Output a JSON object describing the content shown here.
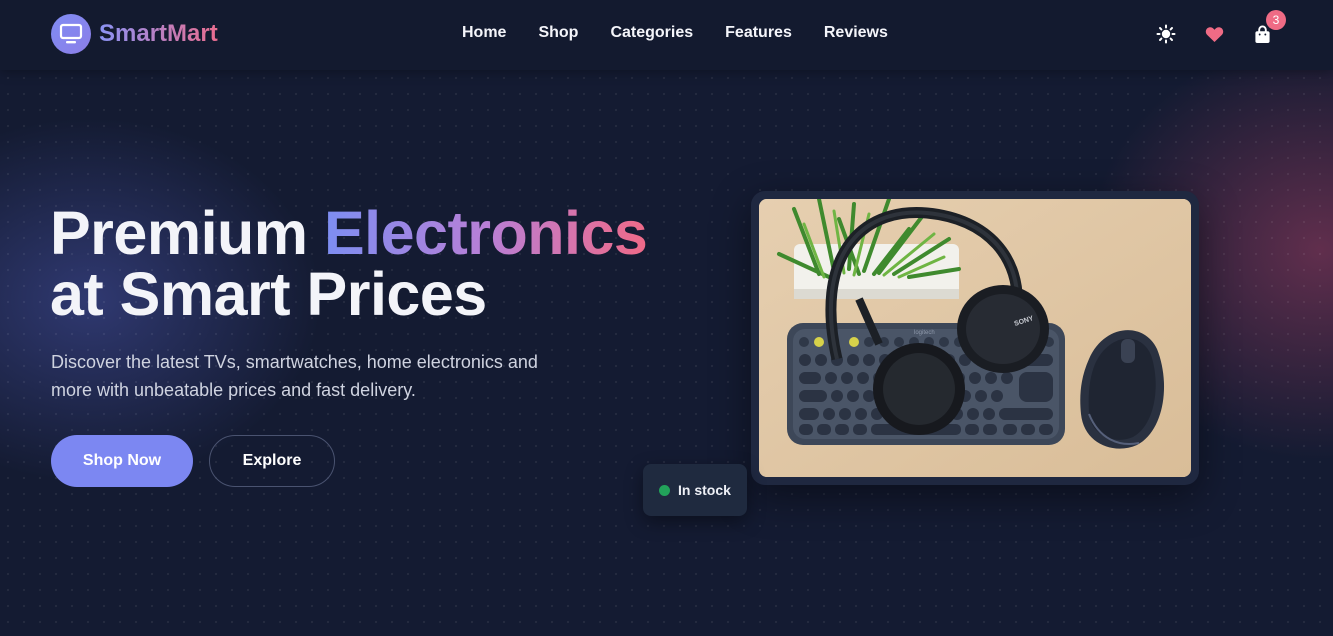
{
  "brand": {
    "name": "SmartMart",
    "icon": "monitor-icon"
  },
  "nav": {
    "items": [
      {
        "label": "Home"
      },
      {
        "label": "Shop"
      },
      {
        "label": "Categories"
      },
      {
        "label": "Features"
      },
      {
        "label": "Reviews"
      }
    ]
  },
  "header_actions": {
    "theme_icon": "sun-icon",
    "wishlist_icon": "heart-icon",
    "cart_icon": "shopping-bag-icon",
    "cart_count": "3"
  },
  "hero": {
    "headline_part1": "Premium ",
    "headline_accent": "Electronics",
    "headline_line2": "at Smart Prices",
    "subtitle": "Discover the latest TVs, smartwatches, home electronics and more with unbeatable prices and fast delivery.",
    "primary_cta": "Shop Now",
    "secondary_cta": "Explore",
    "stock_label": "In stock"
  },
  "image_logos": {
    "keyboard_brand": "logitech",
    "headphone_brand": "SONY"
  },
  "colors": {
    "background": "#141b32",
    "accent_blue": "#7c87f2",
    "accent_pink": "#ef6b85",
    "stock_green": "#22a25a"
  }
}
